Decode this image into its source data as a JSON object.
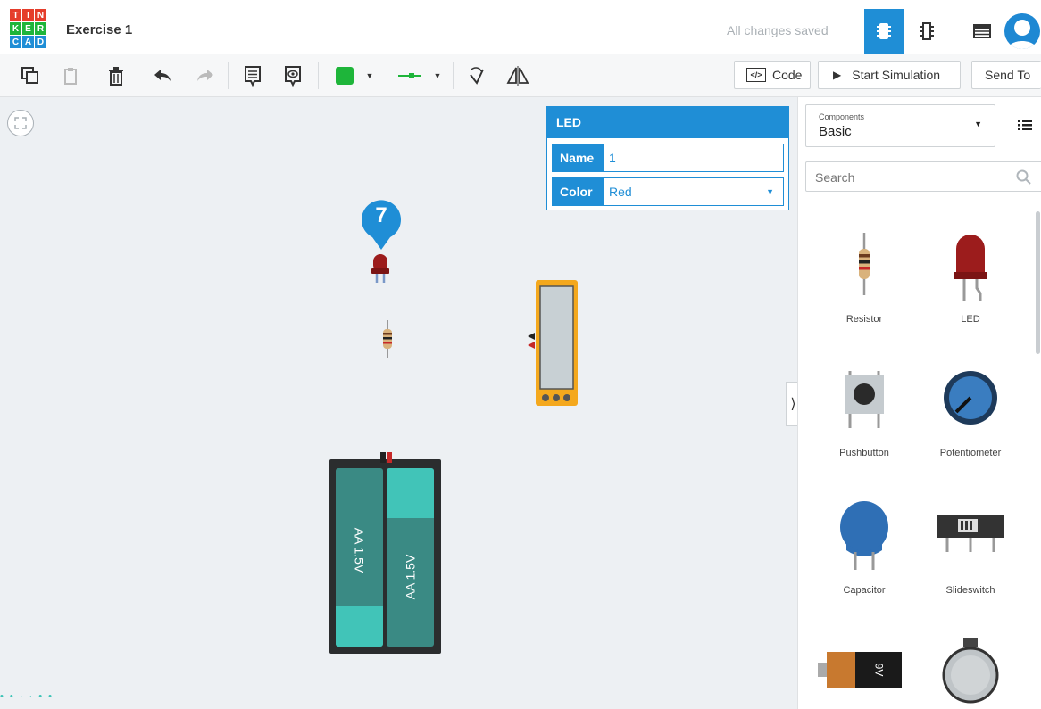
{
  "logo": {
    "letters": [
      "T",
      "I",
      "N",
      "K",
      "E",
      "R",
      "C",
      "A",
      "D"
    ]
  },
  "header": {
    "project_title": "Exercise 1",
    "save_status": "All changes saved"
  },
  "toolbar": {
    "code_label": "Code",
    "start_simulation_label": "Start Simulation",
    "send_to_label": "Send To",
    "fill_color": "#1eb53a",
    "wire_color": "#1eb53a"
  },
  "properties": {
    "title": "LED",
    "name_label": "Name",
    "name_value": "1",
    "color_label": "Color",
    "color_value": "Red"
  },
  "marker": {
    "number": "7"
  },
  "batteries": {
    "left": "AA 1.5V",
    "right": "AA 1.5V"
  },
  "nine_volt": "9V",
  "sidepanel": {
    "components_caption": "Components",
    "components_value": "Basic",
    "search_placeholder": "Search",
    "items": [
      {
        "label": "Resistor",
        "icon": "resistor-icon"
      },
      {
        "label": "LED",
        "icon": "led-icon"
      },
      {
        "label": "Pushbutton",
        "icon": "pushbutton-icon"
      },
      {
        "label": "Potentiometer",
        "icon": "potentiometer-icon"
      },
      {
        "label": "Capacitor",
        "icon": "capacitor-icon"
      },
      {
        "label": "Slideswitch",
        "icon": "slideswitch-icon"
      }
    ]
  },
  "colors": {
    "accent": "#1f8ed6",
    "canvas": "#edf0f3",
    "led_red": "#9c1c1c"
  }
}
